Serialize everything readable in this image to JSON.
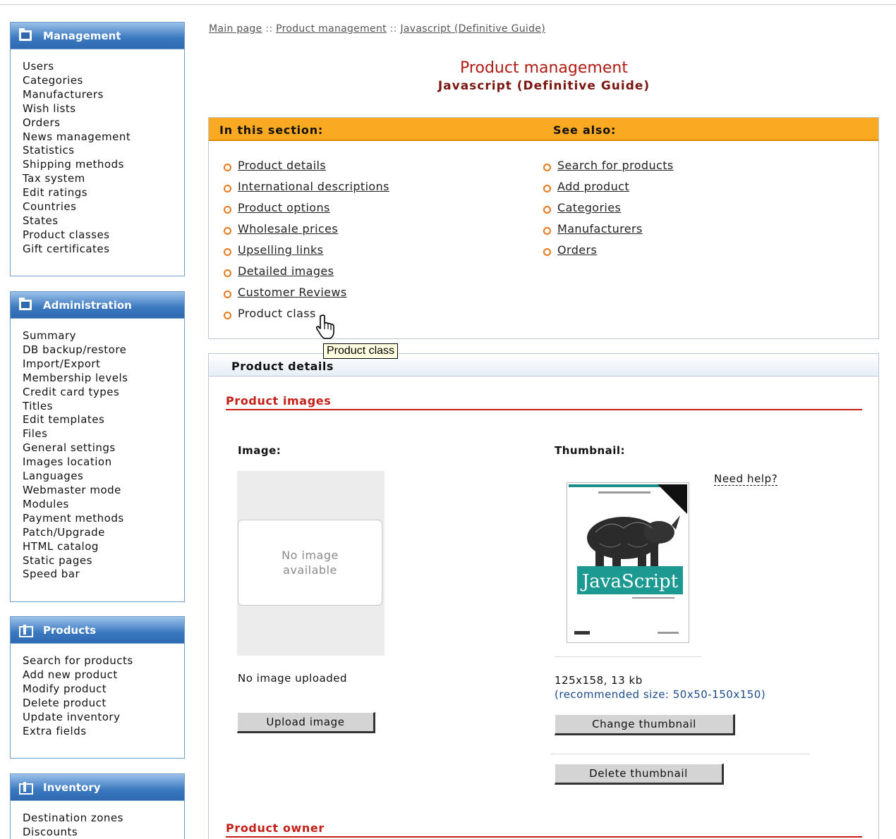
{
  "sidebar": {
    "management": {
      "title": "Management",
      "items": [
        "Users",
        "Categories",
        "Manufacturers",
        "Wish lists",
        "Orders",
        "News management",
        "Statistics",
        "Shipping methods",
        "Tax system",
        "Edit ratings",
        "Countries",
        "States",
        "Product classes",
        "Gift certificates"
      ]
    },
    "administration": {
      "title": "Administration",
      "items": [
        "Summary",
        "DB backup/restore",
        "Import/Export",
        "Membership levels",
        "Credit card types",
        "Titles",
        "Edit templates",
        "Files",
        "General settings",
        "Images location",
        "Languages",
        "Webmaster mode",
        "Modules",
        "Payment methods",
        "Patch/Upgrade",
        "HTML catalog",
        "Static pages",
        "Speed bar"
      ]
    },
    "products": {
      "title": "Products",
      "items": [
        "Search for products",
        "Add new product",
        "Modify product",
        "Delete product",
        "Update inventory",
        "Extra fields"
      ]
    },
    "inventory": {
      "title": "Inventory",
      "items": [
        "Destination zones",
        "Discounts"
      ]
    }
  },
  "breadcrumb": {
    "items": [
      "Main page",
      "Product management",
      "Javascript (Definitive Guide)"
    ],
    "separator": "::"
  },
  "page": {
    "title": "Product management",
    "subtitle": "Javascript (Definitive Guide)"
  },
  "section": {
    "in_this_section_label": "In this section:",
    "see_also_label": "See also:",
    "in_this_section": [
      "Product details",
      "International descriptions",
      "Product options",
      "Wholesale prices",
      "Upselling links",
      "Detailed images",
      "Customer Reviews",
      "Product class"
    ],
    "see_also": [
      "Search for products",
      "Add product",
      "Categories",
      "Manufacturers",
      "Orders"
    ]
  },
  "tooltip": "Product class",
  "details": {
    "tab_label": "Product details",
    "images_heading": "Product images",
    "image_label": "Image:",
    "thumbnail_label": "Thumbnail:",
    "no_image_text": "No image available",
    "no_image_uploaded": "No image uploaded",
    "upload_button": "Upload image",
    "need_help": "Need help?",
    "thumb_info": "125x158, 13 kb",
    "recommended": "(recommended size: 50x50-150x150)",
    "change_button": "Change thumbnail",
    "delete_button": "Delete thumbnail",
    "owner_heading": "Product owner",
    "book_cover_text": "JavaScript"
  },
  "colors": {
    "accent_orange": "#f9a922",
    "title_red": "#b11a12",
    "panel_blue": "#3a78bf",
    "heading_red": "#c51e17"
  }
}
